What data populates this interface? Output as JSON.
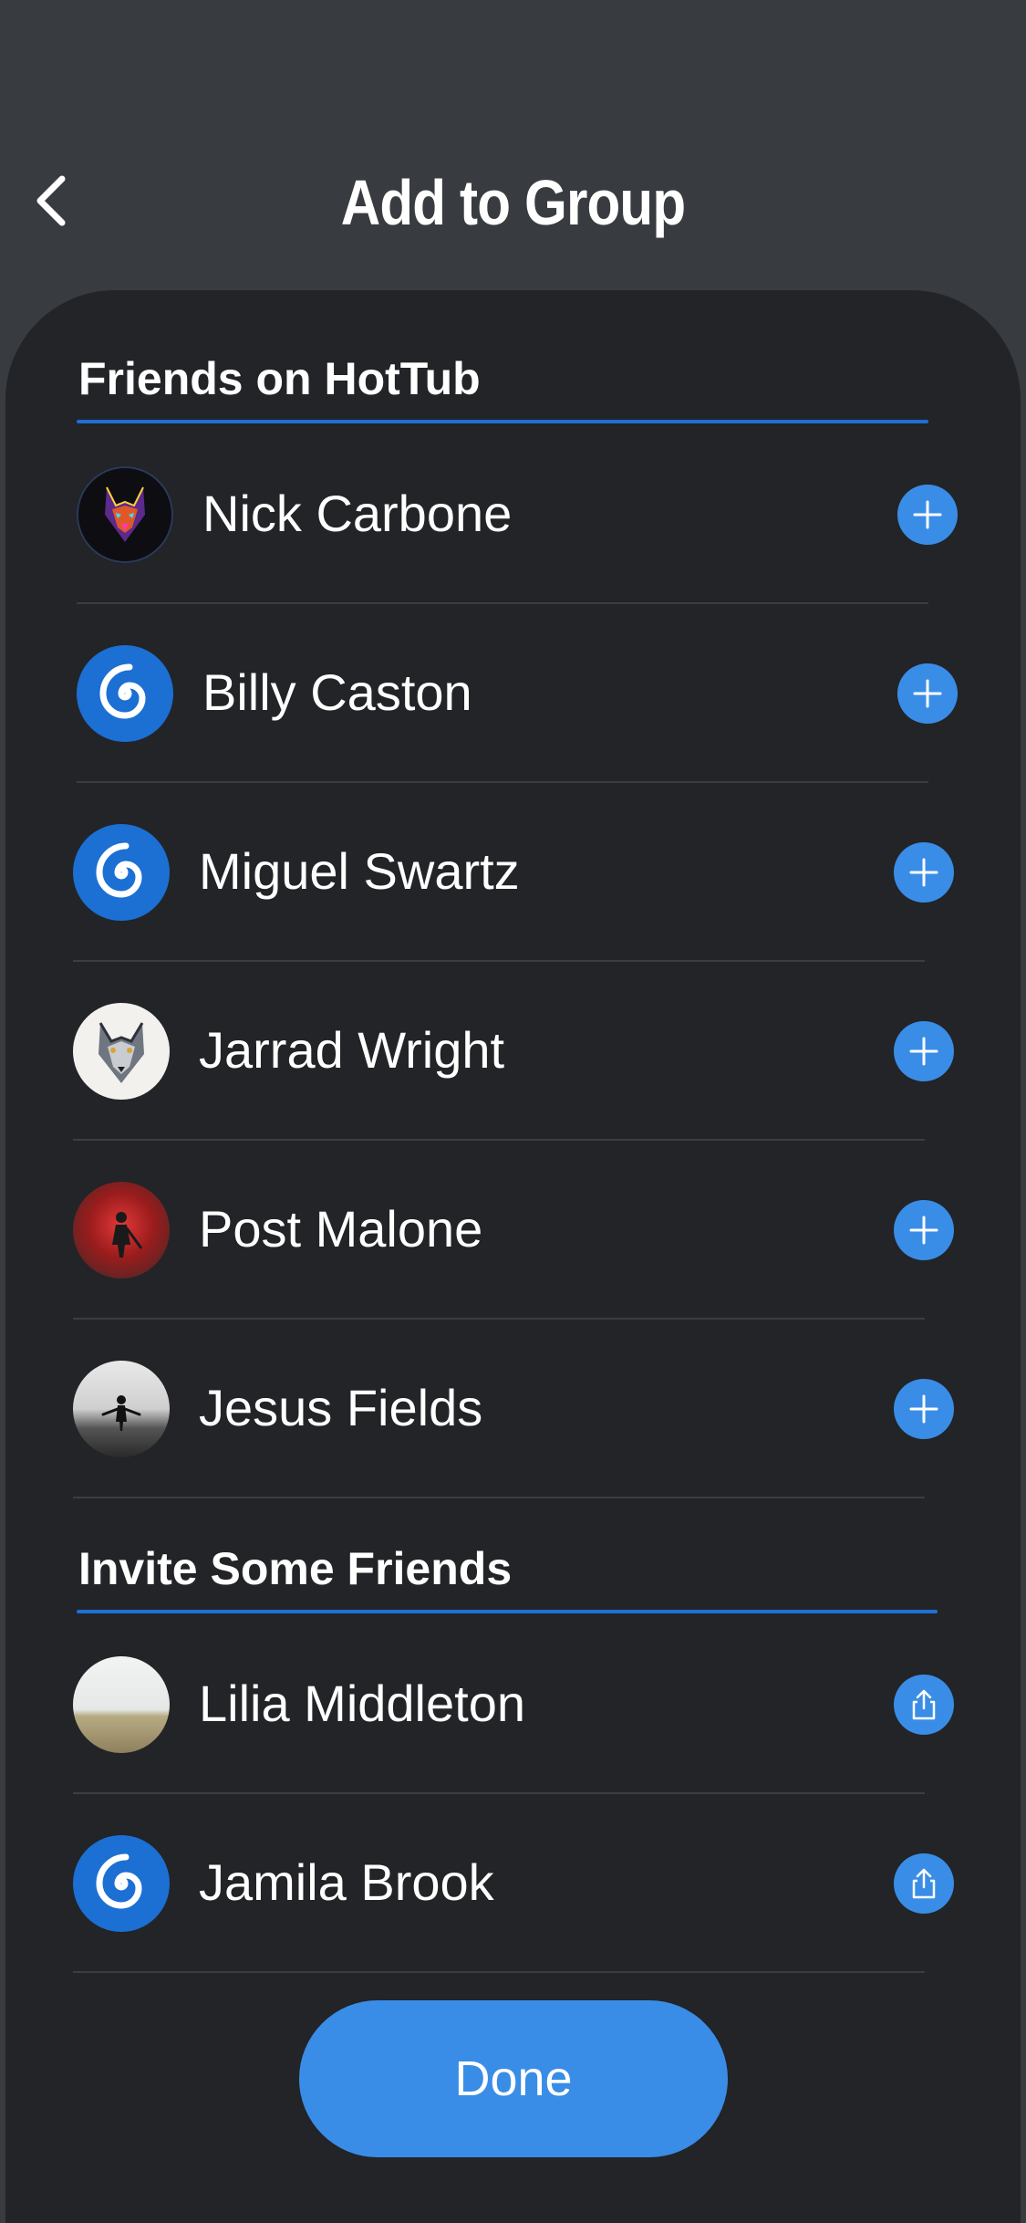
{
  "header": {
    "title": "Add to Group",
    "back_icon": "chevron-left-icon"
  },
  "friends_section": {
    "title": "Friends on HotTub",
    "items": [
      {
        "name": "Nick Carbone",
        "avatar": "neon-wolf",
        "action_icon": "plus-icon"
      },
      {
        "name": "Billy Caston",
        "avatar": "spiral",
        "action_icon": "plus-icon"
      },
      {
        "name": "Miguel Swartz",
        "avatar": "spiral",
        "action_icon": "plus-icon"
      },
      {
        "name": "Jarrad Wright",
        "avatar": "wolf-photo",
        "action_icon": "plus-icon"
      },
      {
        "name": "Post Malone",
        "avatar": "red-sun-figure",
        "action_icon": "plus-icon"
      },
      {
        "name": "Jesus Fields",
        "avatar": "bw-figure",
        "action_icon": "plus-icon"
      }
    ]
  },
  "invite_section": {
    "title": "Invite Some Friends",
    "items": [
      {
        "name": "Lilia Middleton",
        "avatar": "field-photo",
        "action_icon": "share-icon"
      },
      {
        "name": "Jamila Brook",
        "avatar": "spiral",
        "action_icon": "share-icon"
      }
    ]
  },
  "done_button": {
    "label": "Done"
  },
  "colors": {
    "background": "#383b3f",
    "sheet": "#222427",
    "accent": "#3a8de6",
    "section_underline": "#1f6fd6",
    "divider": "#3a3d41"
  }
}
